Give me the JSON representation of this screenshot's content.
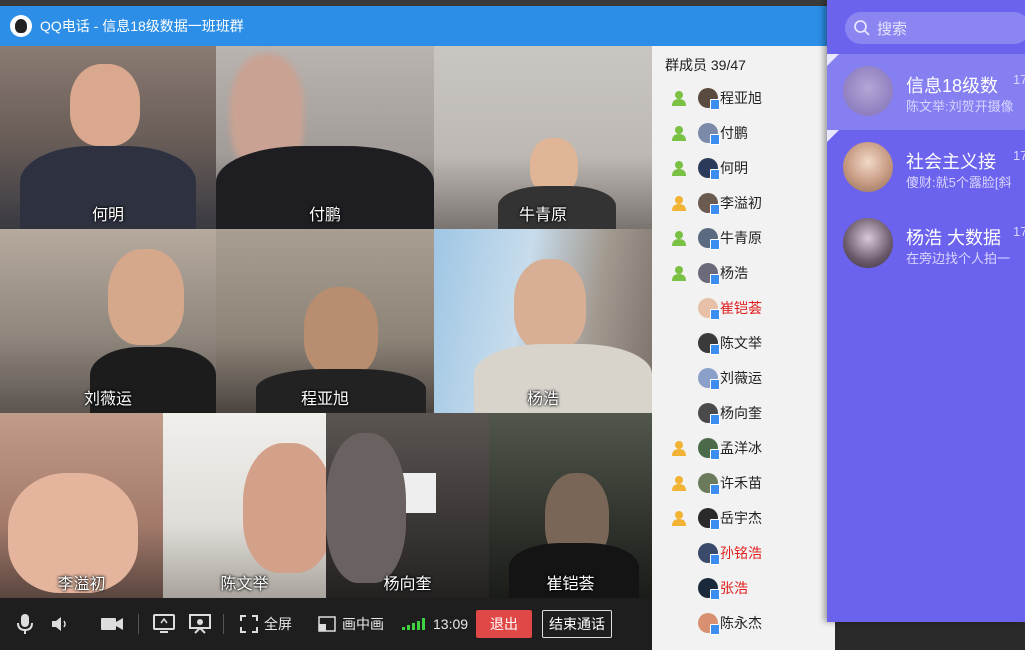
{
  "window": {
    "title": "QQ电话 - 信息18级数据一班班群"
  },
  "video_tiles": [
    {
      "name": "何明"
    },
    {
      "name": "付鹏"
    },
    {
      "name": "牛青原"
    },
    {
      "name": "刘薇运"
    },
    {
      "name": "程亚旭"
    },
    {
      "name": "杨浩"
    },
    {
      "name": "李溢初"
    },
    {
      "name": "陈文举"
    },
    {
      "name": "杨向奎"
    },
    {
      "name": "崔铠荟"
    }
  ],
  "controls": {
    "fullscreen_label": "全屏",
    "pip_label": "画中画",
    "time": "13:09",
    "exit_label": "退出",
    "end_call_label": "结束通话"
  },
  "members": {
    "header": "群成员 39/47",
    "items": [
      {
        "name": "程亚旭",
        "red": false
      },
      {
        "name": "付鹏",
        "red": false
      },
      {
        "name": "何明",
        "red": false
      },
      {
        "name": "李溢初",
        "red": false
      },
      {
        "name": "牛青原",
        "red": false
      },
      {
        "name": "杨浩",
        "red": false
      },
      {
        "name": "崔铠荟",
        "red": true
      },
      {
        "name": "陈文举",
        "red": false
      },
      {
        "name": "刘薇运",
        "red": false
      },
      {
        "name": "杨向奎",
        "red": false
      },
      {
        "name": "孟洋冰",
        "red": false
      },
      {
        "name": "许禾苗",
        "red": false
      },
      {
        "name": "岳宇杰",
        "red": false
      },
      {
        "name": "孙铭浩",
        "red": true
      },
      {
        "name": "张浩",
        "red": true
      },
      {
        "name": "陈永杰",
        "red": false
      }
    ]
  },
  "chat_panel": {
    "search_placeholder": "搜索",
    "chats": [
      {
        "title": "信息18级数",
        "preview": "陈文举:刘贺开摄像",
        "time": "17"
      },
      {
        "title": "社会主义接",
        "preview": "傻财:就5个露脸[斜",
        "time": "17"
      },
      {
        "title": "杨浩  大数据",
        "preview": "在旁边找个人拍一",
        "time": "17"
      }
    ]
  },
  "colors": {
    "titlebar": "#2c8ee6",
    "chat_panel": "#6b63ee",
    "exit_button": "#e04848",
    "member_red": "#e02020",
    "signal": "#3fd13f"
  }
}
